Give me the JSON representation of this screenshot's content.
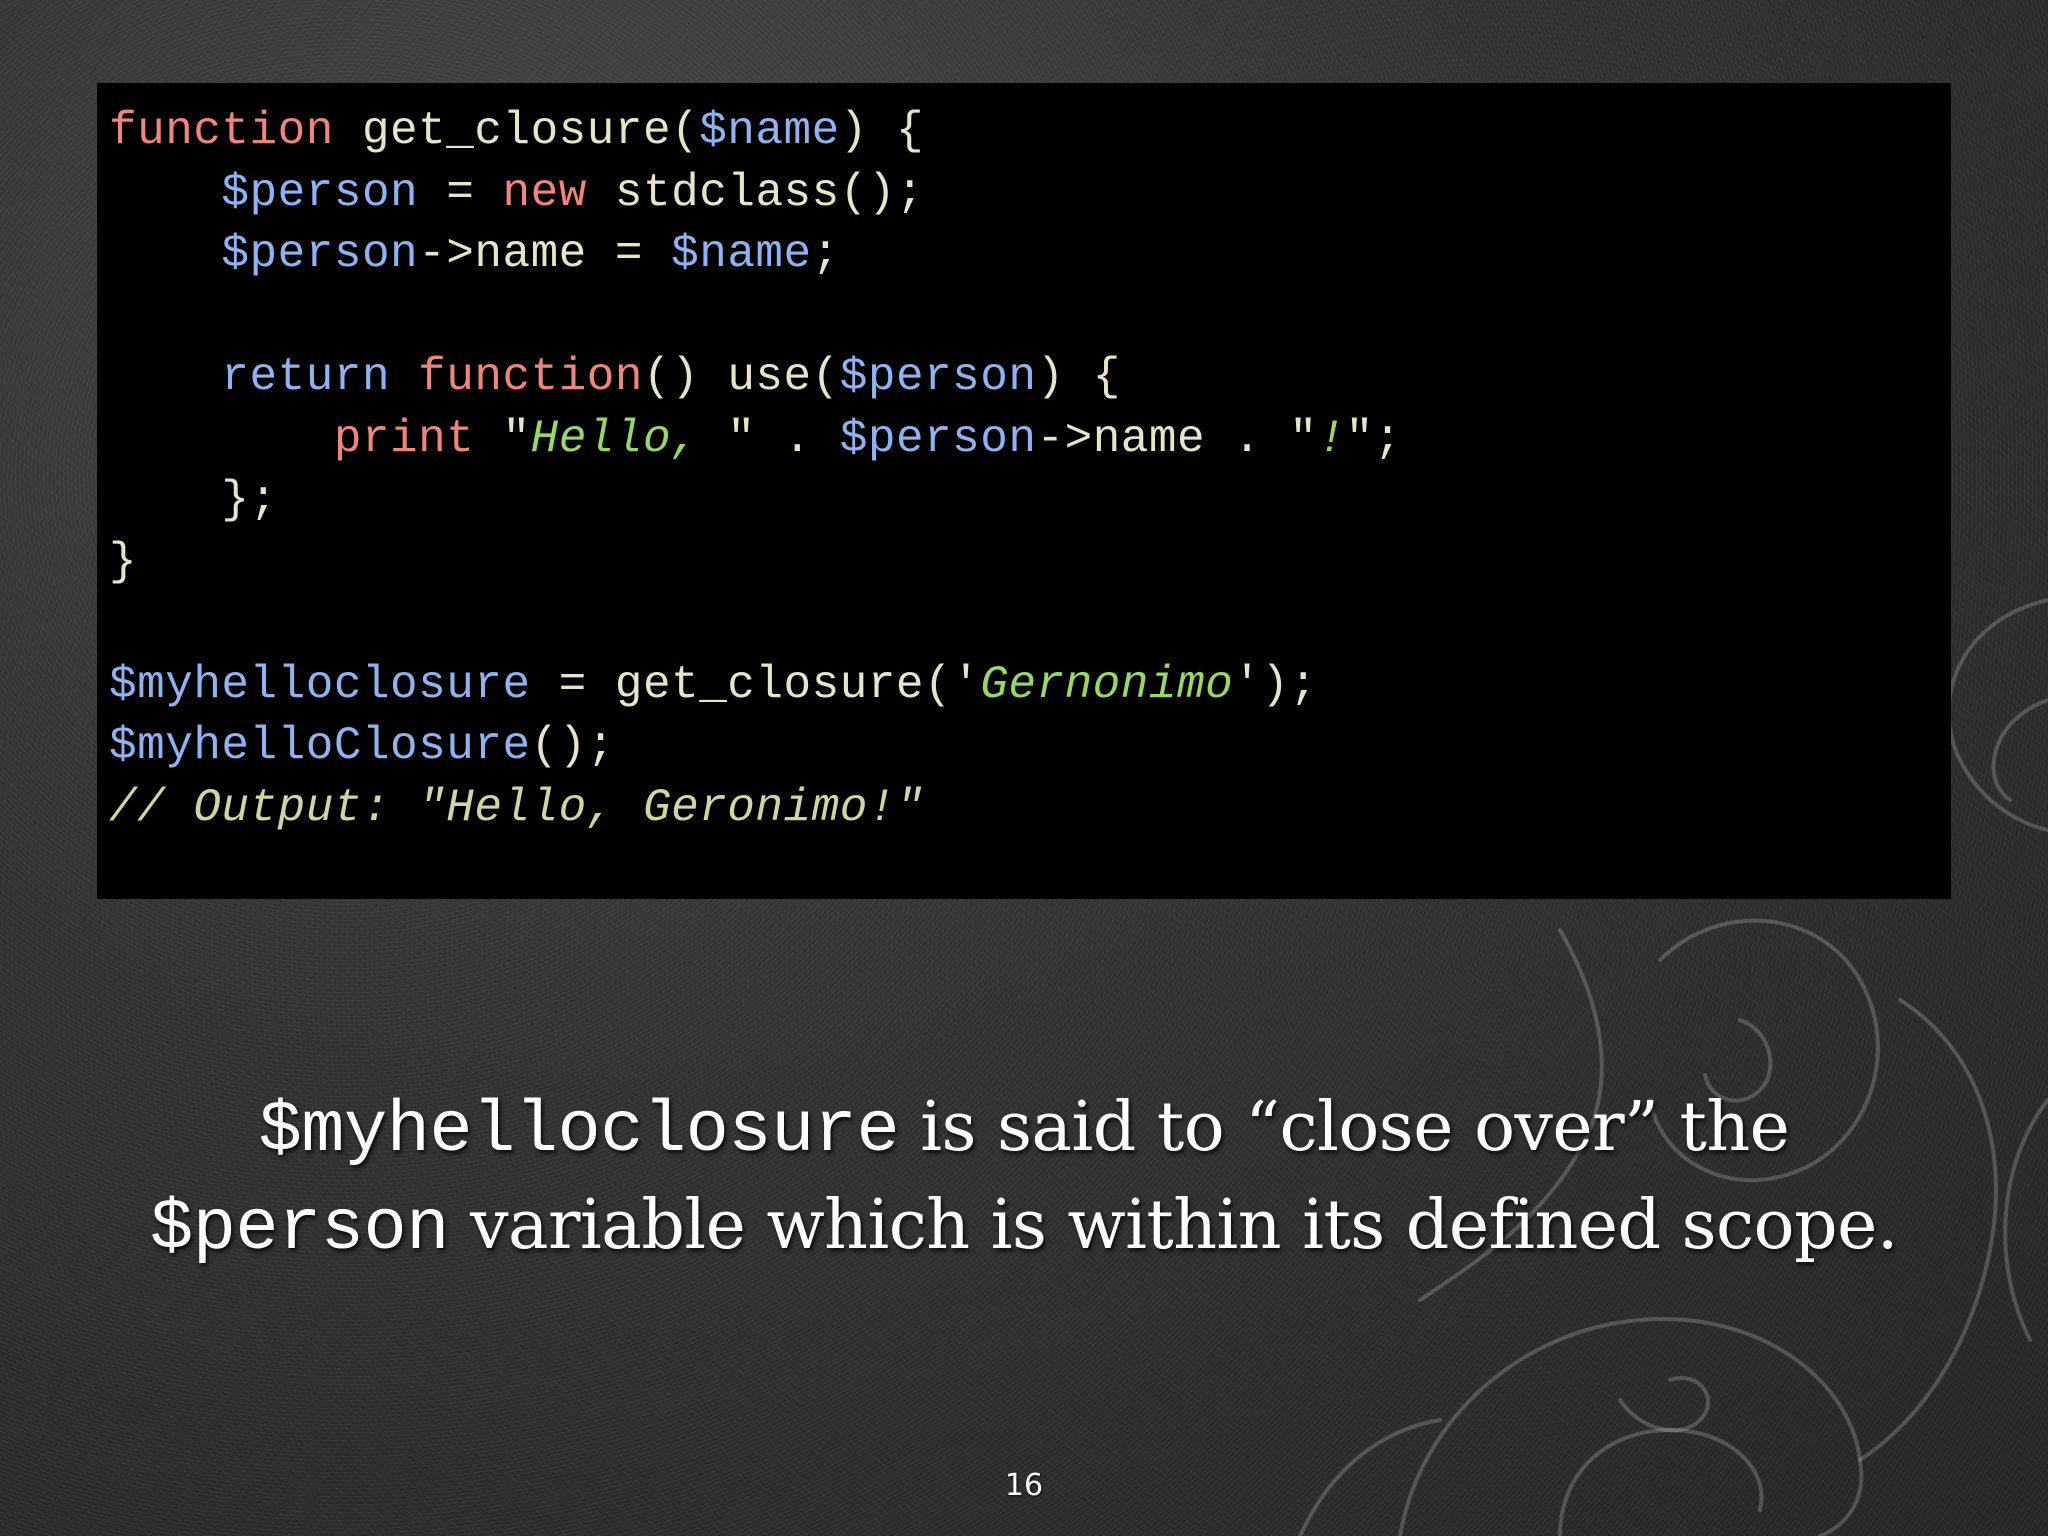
{
  "slide": {
    "code_lines": [
      [
        {
          "t": "function",
          "c": "kw"
        },
        {
          "t": " get_closure("
        },
        {
          "t": "$name",
          "c": "var"
        },
        {
          "t": ") {"
        }
      ],
      [
        {
          "t": "    "
        },
        {
          "t": "$person",
          "c": "var"
        },
        {
          "t": " = "
        },
        {
          "t": "new",
          "c": "kw"
        },
        {
          "t": " stdclass();"
        }
      ],
      [
        {
          "t": "    "
        },
        {
          "t": "$person",
          "c": "var"
        },
        {
          "t": "->name = "
        },
        {
          "t": "$name",
          "c": "var"
        },
        {
          "t": ";"
        }
      ],
      [],
      [
        {
          "t": "    "
        },
        {
          "t": "return",
          "c": "rt"
        },
        {
          "t": " "
        },
        {
          "t": "function",
          "c": "kw"
        },
        {
          "t": "() use("
        },
        {
          "t": "$person",
          "c": "var"
        },
        {
          "t": ") {"
        }
      ],
      [
        {
          "t": "        "
        },
        {
          "t": "print",
          "c": "kw"
        },
        {
          "t": " \""
        },
        {
          "t": "Hello, ",
          "c": "str"
        },
        {
          "t": "\" . "
        },
        {
          "t": "$person",
          "c": "var"
        },
        {
          "t": "->name . \""
        },
        {
          "t": "!",
          "c": "str"
        },
        {
          "t": "\";"
        }
      ],
      [
        {
          "t": "    };"
        }
      ],
      [
        {
          "t": "}"
        }
      ],
      [],
      [
        {
          "t": "$myhelloclosure",
          "c": "var"
        },
        {
          "t": " = get_closure('"
        },
        {
          "t": "Gernonimo",
          "c": "str"
        },
        {
          "t": "');"
        }
      ],
      [
        {
          "t": "$myhelloClosure",
          "c": "var"
        },
        {
          "t": "();"
        }
      ],
      [
        {
          "t": "// Output: \"Hello, Geronimo!\"",
          "c": "cmt"
        }
      ]
    ],
    "caption_line1": {
      "code": "$myhelloclosure",
      "text": " is said to “close over” the"
    },
    "caption_line2": {
      "code": "$person",
      "text": " variable which is within its defined scope."
    },
    "page_number": "16"
  }
}
